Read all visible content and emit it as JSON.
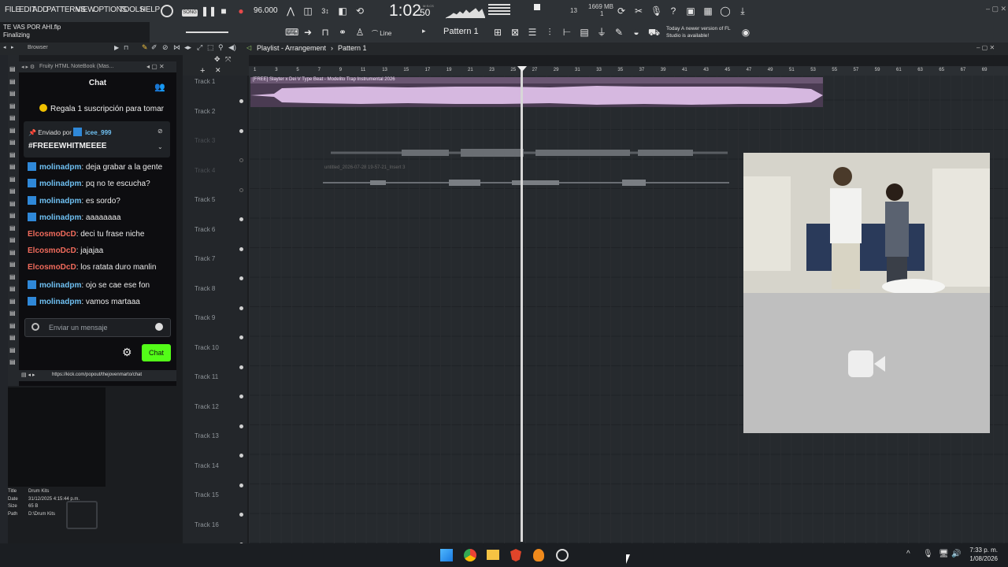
{
  "menu": [
    "FILE",
    "EDIT",
    "ADD",
    "PATTERNS",
    "VIEW",
    "OPTIONS",
    "TOOLS",
    "HELP"
  ],
  "transport": {
    "bpm": "96.000",
    "time": "1:02",
    "time_sub": "50",
    "time_unit": "M:S:CS",
    "cpu": "13",
    "mem": "1669 MB",
    "mem2": "1"
  },
  "file": {
    "name": "TE VAS POR AHI.flp",
    "status": "Finalizing"
  },
  "toolbar2": {
    "snap": "Line",
    "pattern": "Pattern 1",
    "news_label": "Today",
    "news_text": "A newer version of FL Studio is available!"
  },
  "browser_label": "Browser",
  "playlist_title": "Playlist - Arrangement",
  "playlist_pattern": "Pattern 1",
  "notebook_title": "Fruity HTML NoteBook (Mas...",
  "chat": {
    "title": "Chat",
    "gift": "Regala 1 suscripción para tomar",
    "pinned_by": "Enviado por",
    "pinned_user": "icee_999",
    "pinned_msg": "#FREEEWHITMEEEE",
    "messages": [
      {
        "user": "molinadpm",
        "text": "deja grabar a la gente",
        "color": "blue"
      },
      {
        "user": "molinadpm",
        "text": "pq no te escucha?",
        "color": "blue"
      },
      {
        "user": "molinadpm",
        "text": "es sordo?",
        "color": "blue"
      },
      {
        "user": "molinadpm",
        "text": "aaaaaaaa",
        "color": "blue"
      },
      {
        "user": "ElcosmoDcD",
        "text": "deci tu frase niche",
        "color": "red"
      },
      {
        "user": "ElcosmoDcD",
        "text": "jajajaa",
        "color": "red"
      },
      {
        "user": "ElcosmoDcD",
        "text": "los ratata duro manlin",
        "color": "red"
      },
      {
        "user": "molinadpm",
        "text": "ojo se cae ese fon",
        "color": "blue"
      },
      {
        "user": "molinadpm",
        "text": "vamos martaaa",
        "color": "blue"
      }
    ],
    "input_placeholder": "Enviar un mensaje",
    "send_label": "Chat",
    "url": "https://kick.com/popout/thejovenmarto/chat"
  },
  "file_info": {
    "title_label": "Title",
    "title": "Drum Kits",
    "date_label": "Date",
    "date": "31/12/2025 4:15:44 p.m.",
    "size_label": "Size",
    "size": "65 B",
    "path_label": "Path",
    "path": "D:\\Drum Kits"
  },
  "tracks": [
    "Track 1",
    "Track 2",
    "Track 3",
    "Track 4",
    "Track 5",
    "Track 6",
    "Track 7",
    "Track 8",
    "Track 9",
    "Track 10",
    "Track 11",
    "Track 12",
    "Track 13",
    "Track 14",
    "Track 15",
    "Track 16"
  ],
  "ruler": [
    "1",
    "3",
    "5",
    "7",
    "9",
    "11",
    "13",
    "15",
    "17",
    "19",
    "21",
    "23",
    "25",
    "27",
    "29",
    "31",
    "33",
    "35",
    "37",
    "39",
    "41",
    "43",
    "45",
    "47",
    "49",
    "51",
    "53",
    "55",
    "57",
    "59",
    "61",
    "63",
    "65",
    "67",
    "69"
  ],
  "clips": {
    "clip1": "[FREE] Slayter x Dei V Type Beat - Modelito  Trap Instrumental 2026",
    "clip4": "untitled_2026-07-28 19-57-21_Insert 3"
  },
  "taskbar": {
    "time": "7:33 p. m.",
    "date": "1/08/2026"
  }
}
